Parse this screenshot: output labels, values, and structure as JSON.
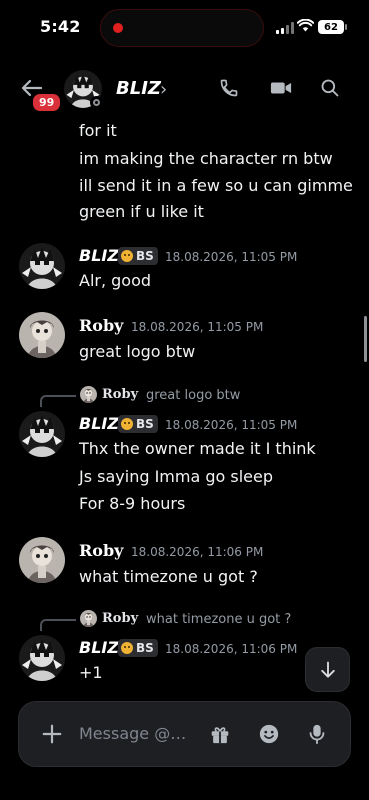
{
  "status_bar": {
    "time": "5:42",
    "battery": "62"
  },
  "header": {
    "name": "BLIZ",
    "unread_badge": "99",
    "chevron": "›"
  },
  "messages": {
    "continuation": [
      "for it",
      "im making the character rn btw",
      "ill send it in a few so u can gimme",
      "green if u like it"
    ],
    "m1": {
      "author": "BLIZ",
      "tag": "BS",
      "timestamp": "18.08.2026, 11:05 PM",
      "lines": [
        "Alr, good"
      ]
    },
    "m2": {
      "author": "Roby",
      "timestamp": "18.08.2026, 11:05 PM",
      "lines": [
        "great logo btw"
      ]
    },
    "m3": {
      "reply_to": {
        "author": "Roby",
        "text": "great logo btw"
      },
      "author": "BLIZ",
      "tag": "BS",
      "timestamp": "18.08.2026, 11:05 PM",
      "lines": [
        "Thx the owner made it I think",
        "Js saying Imma go sleep",
        "For 8-9 hours"
      ]
    },
    "m4": {
      "author": "Roby",
      "timestamp": "18.08.2026, 11:06 PM",
      "lines": [
        "what timezone u got  ?"
      ]
    },
    "m5": {
      "reply_to": {
        "author": "Roby",
        "text": "what timezone u got  ?"
      },
      "author": "BLIZ",
      "tag": "BS",
      "timestamp": "18.08.2026, 11:06 PM",
      "lines": [
        "+1"
      ]
    }
  },
  "composer": {
    "placeholder": "Message @…"
  },
  "icons": {
    "back": "arrow-left-icon",
    "call": "phone-icon",
    "video": "video-camera-icon",
    "search": "search-icon",
    "plus": "plus-icon",
    "gift": "gift-icon",
    "emoji": "emoji-icon",
    "mic": "microphone-icon",
    "jump": "arrow-down-icon"
  },
  "colors": {
    "background": "#000000",
    "badge": "#d9303a",
    "muted": "#949ba4",
    "tag_icon": "#f0b232",
    "recording": "#e0211f"
  }
}
